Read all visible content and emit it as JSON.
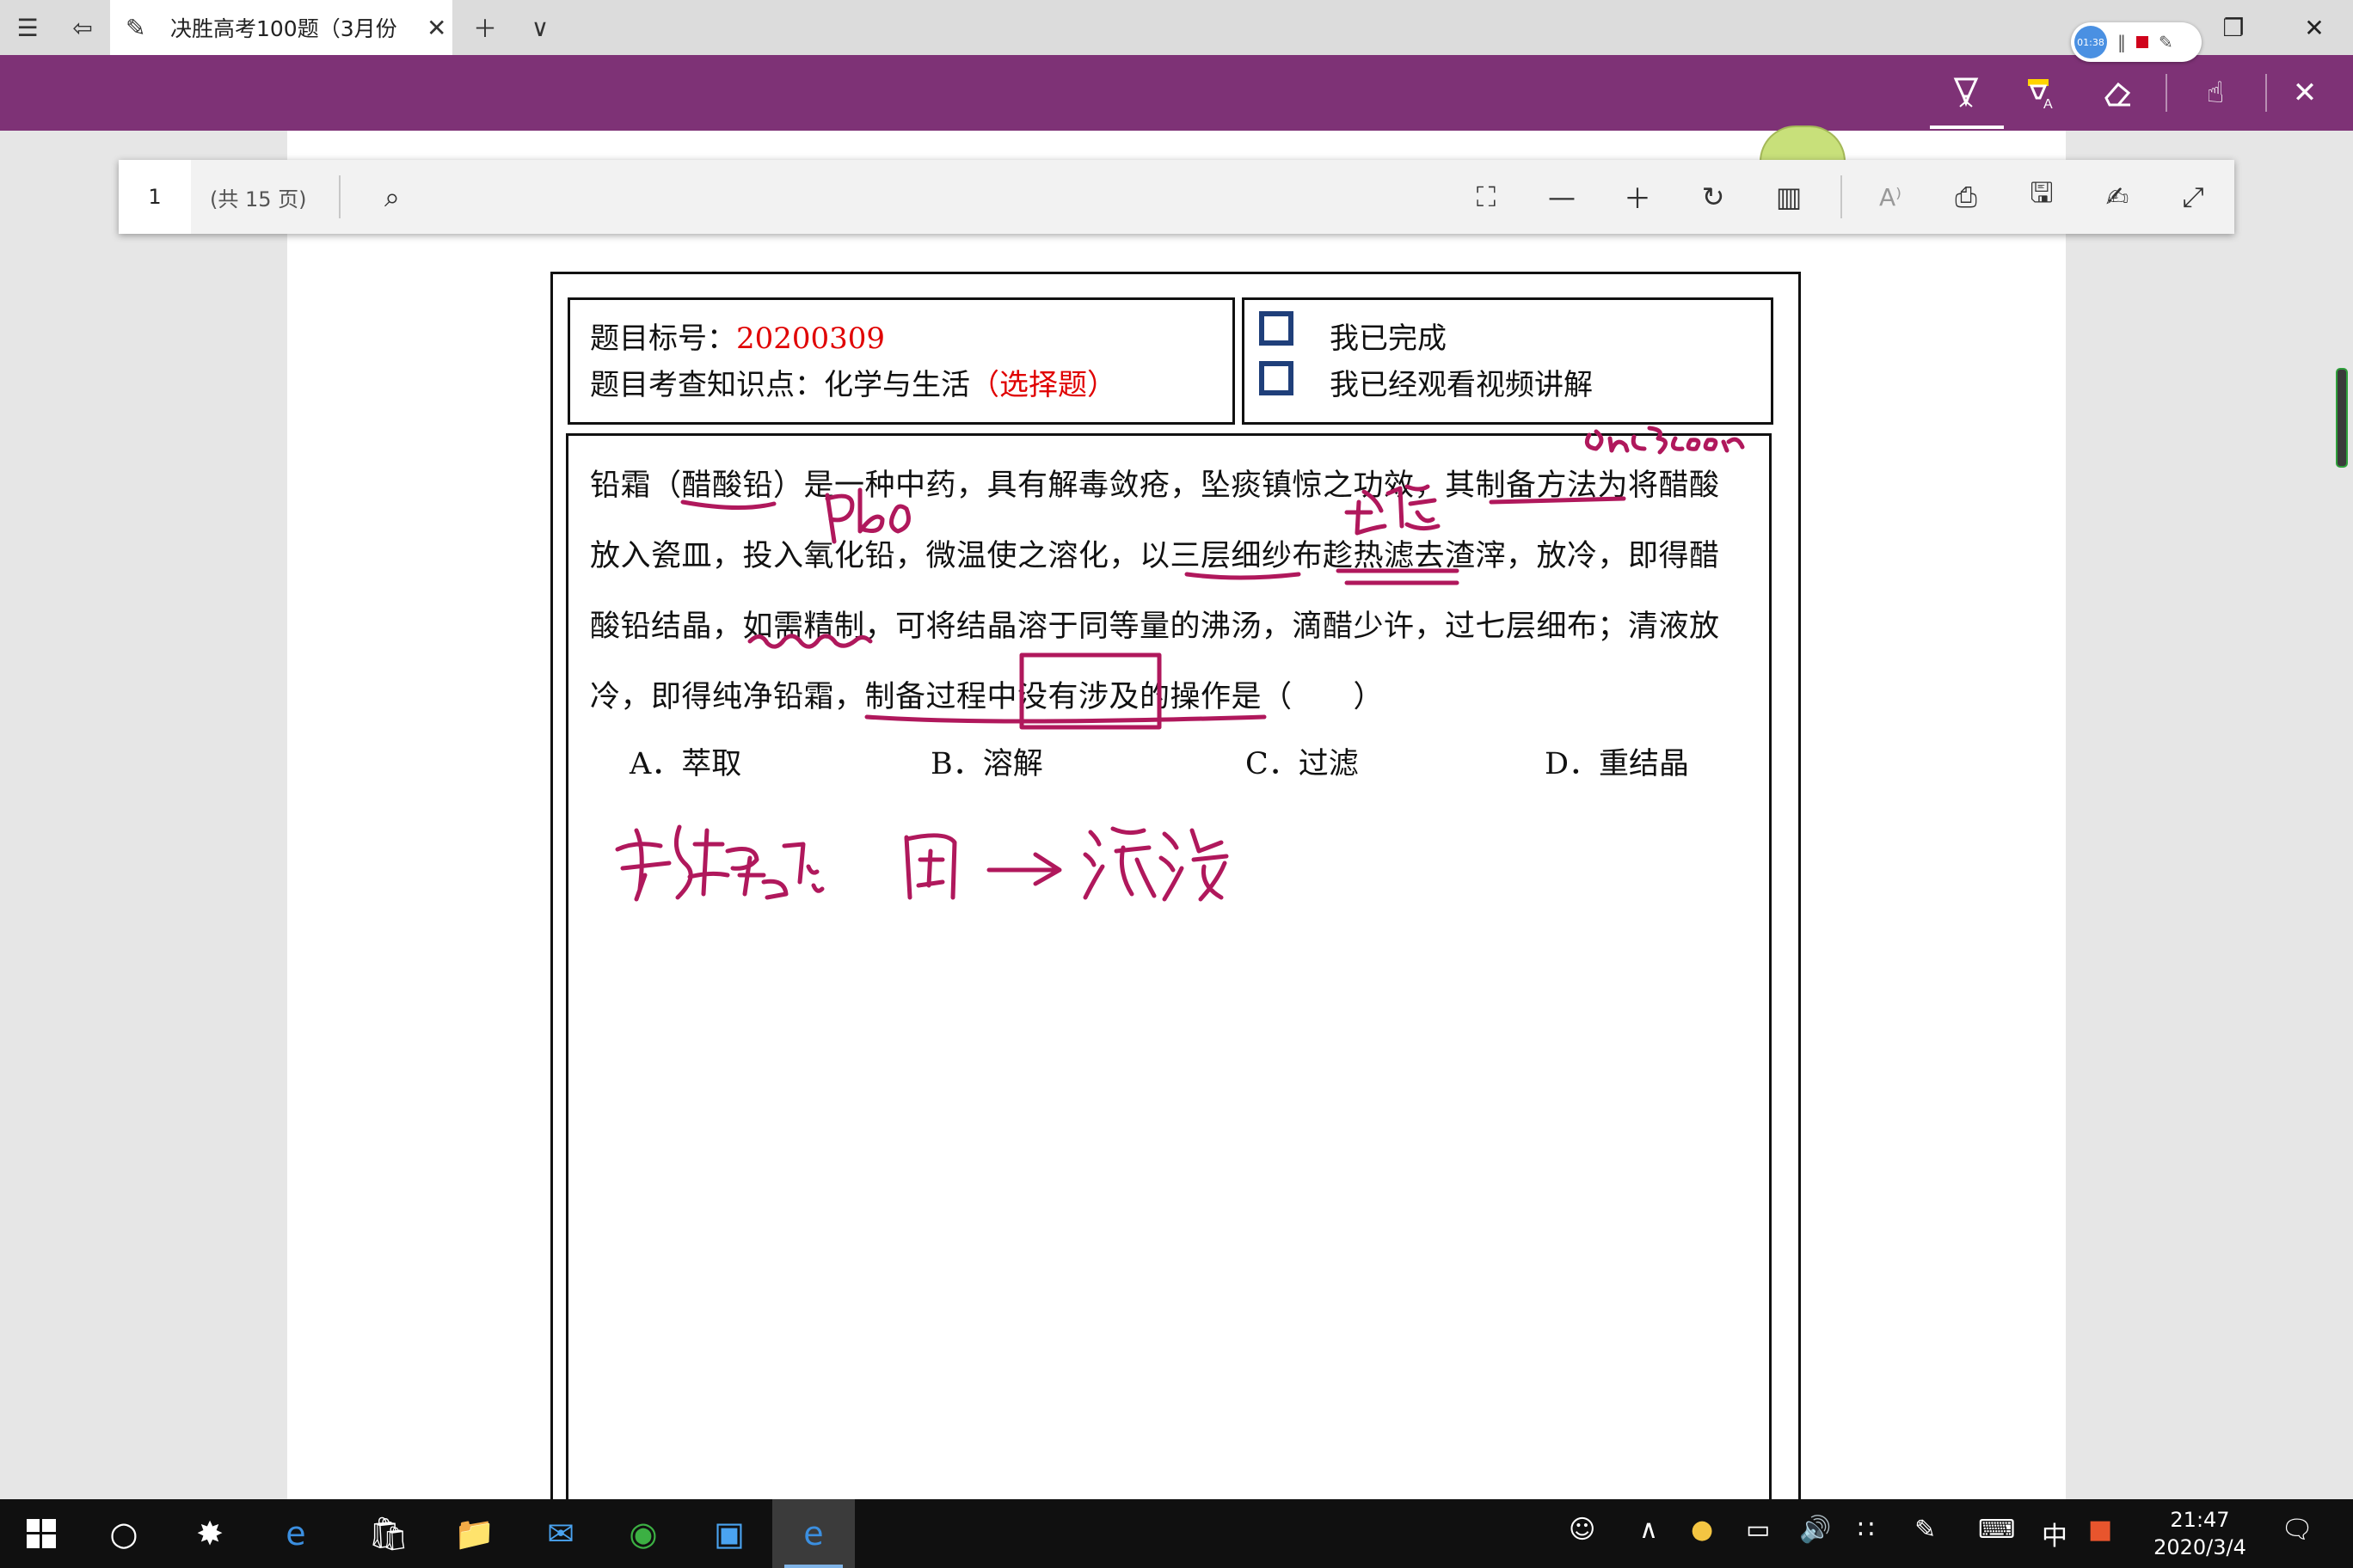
{
  "titlebar": {
    "tab_title": "决胜高考100题（3月份",
    "recorder_time": "01:38"
  },
  "pdf_toolbar": {
    "page_value": "1",
    "page_total": "(共 15 页)"
  },
  "question": {
    "id_label": "题目标号：",
    "id_value": "20200309",
    "topic_label": "题目考查知识点：化学与生活",
    "topic_type": "（选择题）",
    "check_done": "我已完成",
    "check_video": "我已经观看视频讲解",
    "paragraph_lines": [
      "铅霜（醋酸铅）是一种中药，具有解毒敛疮，坠痰镇惊之功效，其制备方法为将醋酸",
      "放入瓷皿，投入氧化铅，微温使之溶化，以三层细纱布趁热滤去渣滓，放冷，即得醋",
      "酸铅结晶，如需精制，可将结晶溶于同等量的沸汤，滴醋少许，过七层细布；清液放",
      "冷，即得纯净铅霜，制备过程中没有涉及的操作是（　　）"
    ],
    "options": [
      "A．萃取",
      "B．溶解",
      "C．过滤",
      "D．重结晶"
    ]
  },
  "taskbar": {
    "clock_time": "21:47",
    "clock_date": "2020/3/4",
    "ime": "中"
  },
  "colors": {
    "ink_bar": "#7e3276",
    "handwriting": "#b0185c",
    "answer_red": "#e00000",
    "checkbox": "#1f3f7a"
  }
}
